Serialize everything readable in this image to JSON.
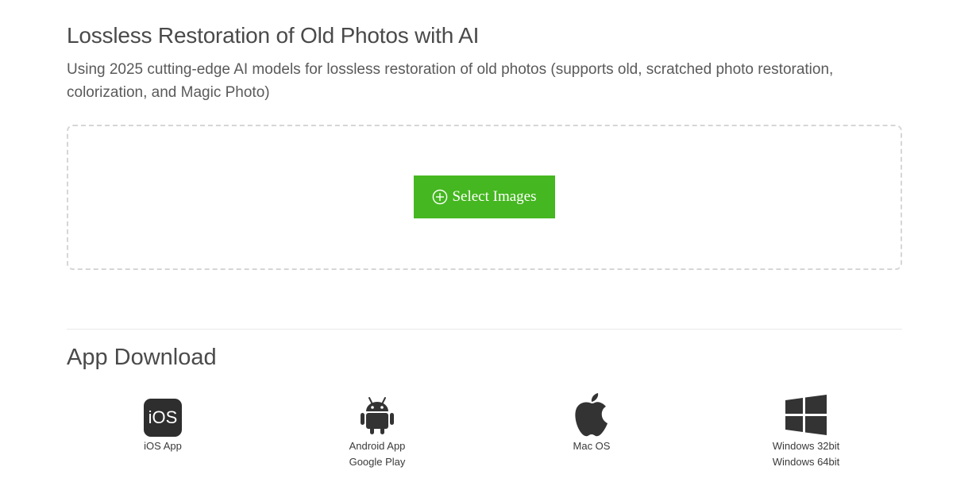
{
  "header": {
    "title": "Lossless Restoration of Old Photos with AI",
    "description": "Using 2025 cutting-edge AI models for lossless restoration of old photos (supports old, scratched photo restoration, colorization, and Magic Photo)"
  },
  "upload": {
    "button_label": "Select Images",
    "button_icon": "plus-circle-icon",
    "accent_color": "#45b720"
  },
  "downloads": {
    "title": "App Download",
    "items": [
      {
        "icon": "ios-icon",
        "icon_text": "iOS",
        "line1": "iOS App",
        "line2": ""
      },
      {
        "icon": "android-icon",
        "line1": "Android App",
        "line2": "Google Play"
      },
      {
        "icon": "apple-icon",
        "line1": "Mac OS",
        "line2": ""
      },
      {
        "icon": "windows-icon",
        "line1": "Windows 32bit",
        "line2": "Windows 64bit"
      }
    ]
  }
}
